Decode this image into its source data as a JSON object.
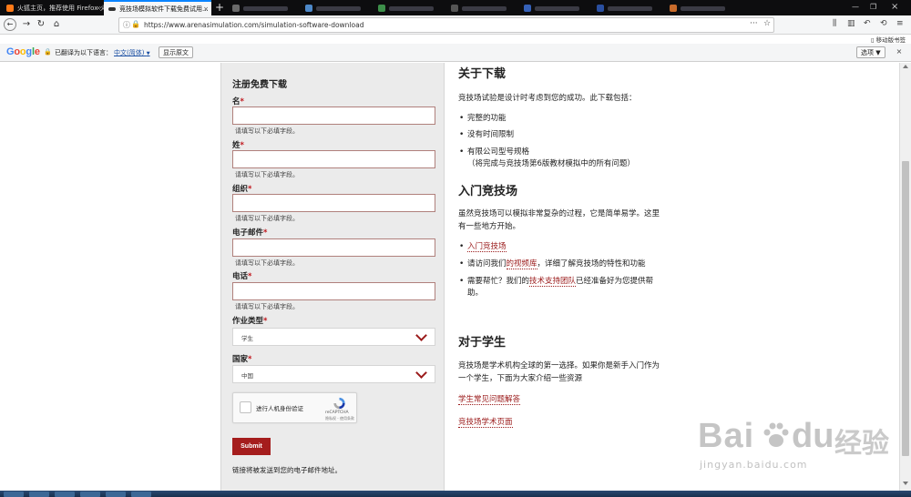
{
  "browser": {
    "tabs": [
      {
        "title": "火狐主页，推荐使用 Firefox 火...",
        "active": false
      },
      {
        "title": "竞技场模拟软件下载免费试用...",
        "active": true
      },
      {
        "title": "",
        "active": false
      },
      {
        "title": "",
        "active": false
      },
      {
        "title": "",
        "active": false
      },
      {
        "title": "",
        "active": false
      },
      {
        "title": "",
        "active": false
      }
    ],
    "url": "https://www.arenasimulation.com/simulation-software-download",
    "url_more": "···",
    "mobile_bookmarks": "移动版书签"
  },
  "translate_bar": {
    "brand": [
      "G",
      "o",
      "o",
      "g",
      "l",
      "e"
    ],
    "brand_colors": [
      "#4285f4",
      "#ea4335",
      "#fbbc05",
      "#4285f4",
      "#34a853",
      "#ea4335"
    ],
    "translated_to_label": "已翻译为以下语言：",
    "language": "中文(简体)",
    "show_original": "显示原文",
    "options": "选项 ▼",
    "close": "×"
  },
  "form": {
    "heading": "注册免费下载",
    "fields": [
      {
        "label": "名",
        "required": "*",
        "hint": "请填写以下必填字段。"
      },
      {
        "label": "姓",
        "required": "*",
        "hint": "请填写以下必填字段。"
      },
      {
        "label": "组织",
        "required": "*",
        "hint": "请填写以下必填字段。"
      },
      {
        "label": "电子邮件",
        "required": "*",
        "hint": "请填写以下必填字段。"
      },
      {
        "label": "电话",
        "required": "*",
        "hint": "请填写以下必填字段。"
      }
    ],
    "job_type": {
      "label": "作业类型",
      "required": "*",
      "value": "学生"
    },
    "country": {
      "label": "国家",
      "required": "*",
      "value": "中国"
    },
    "captcha": {
      "label": "进行人机身份验证",
      "brand": "reCAPTCHA",
      "terms": "隐私权 - 使用条款"
    },
    "submit": "Submit",
    "note": "链接将被发送到您的电子邮件地址。"
  },
  "about": {
    "heading": "关于下载",
    "intro": "竞技场试验是设计时考虑到您的成功。此下载包括：",
    "items": [
      "完整的功能",
      "没有时间限制",
      "有限公司型号规格",
      "（将完成与竞技场第6版教材模拟中的所有问题）"
    ]
  },
  "getting_started": {
    "heading": "入门竞技场",
    "intro_line1": "虽然竞技场可以模拟非常复杂的过程，它是简单易学。这里",
    "intro_line2": "有一些地方开始。",
    "link1": "入门竞技场",
    "item2_pre": "请访问我们",
    "item2_link": "的视频库",
    "item2_post": "，详细了解竞技场的特性和功能",
    "item3_pre": "需要帮忙？我们的",
    "item3_link": "技术支持团队",
    "item3_post": "已经准备好为您提供帮",
    "item3_post2": "助。"
  },
  "students": {
    "heading": "对于学生",
    "intro_line1": "竞技场是学术机构全球的第一选择。如果你是新手入门作为",
    "intro_line2": "一个学生，下面为大家介绍一些资源",
    "link1": "学生常见问题解答",
    "link2": "竞技场学术页面"
  },
  "watermark": {
    "brand1": "Bai",
    "brand2": "du",
    "brand3": "经验",
    "url": "jingyan.baidu.com"
  }
}
